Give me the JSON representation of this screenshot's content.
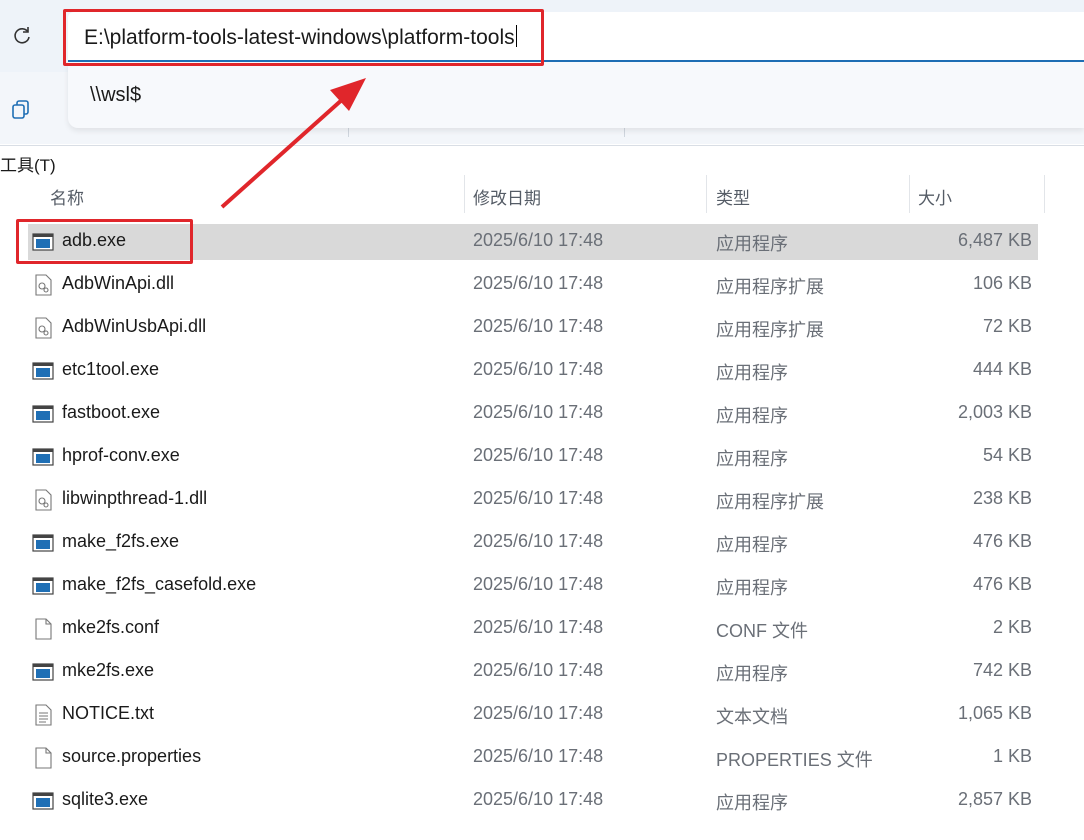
{
  "address_bar": {
    "path": "E:\\platform-tools-latest-windows\\platform-tools"
  },
  "suggestion": {
    "item": "\\\\wsl$"
  },
  "menu": {
    "tools": "工具(T)"
  },
  "columns": {
    "name": "名称",
    "date": "修改日期",
    "type": "类型",
    "size": "大小"
  },
  "files": [
    {
      "name": "adb.exe",
      "date": "2025/6/10 17:48",
      "type": "应用程序",
      "size": "6,487 KB",
      "icon": "exe-icon",
      "selected": true
    },
    {
      "name": "AdbWinApi.dll",
      "date": "2025/6/10 17:48",
      "type": "应用程序扩展",
      "size": "106 KB",
      "icon": "dll-icon"
    },
    {
      "name": "AdbWinUsbApi.dll",
      "date": "2025/6/10 17:48",
      "type": "应用程序扩展",
      "size": "72 KB",
      "icon": "dll-icon"
    },
    {
      "name": "etc1tool.exe",
      "date": "2025/6/10 17:48",
      "type": "应用程序",
      "size": "444 KB",
      "icon": "exe-icon"
    },
    {
      "name": "fastboot.exe",
      "date": "2025/6/10 17:48",
      "type": "应用程序",
      "size": "2,003 KB",
      "icon": "exe-icon"
    },
    {
      "name": "hprof-conv.exe",
      "date": "2025/6/10 17:48",
      "type": "应用程序",
      "size": "54 KB",
      "icon": "exe-icon"
    },
    {
      "name": "libwinpthread-1.dll",
      "date": "2025/6/10 17:48",
      "type": "应用程序扩展",
      "size": "238 KB",
      "icon": "dll-icon"
    },
    {
      "name": "make_f2fs.exe",
      "date": "2025/6/10 17:48",
      "type": "应用程序",
      "size": "476 KB",
      "icon": "exe-icon"
    },
    {
      "name": "make_f2fs_casefold.exe",
      "date": "2025/6/10 17:48",
      "type": "应用程序",
      "size": "476 KB",
      "icon": "exe-icon"
    },
    {
      "name": "mke2fs.conf",
      "date": "2025/6/10 17:48",
      "type": "CONF 文件",
      "size": "2 KB",
      "icon": "blank-file-icon"
    },
    {
      "name": "mke2fs.exe",
      "date": "2025/6/10 17:48",
      "type": "应用程序",
      "size": "742 KB",
      "icon": "exe-icon"
    },
    {
      "name": "NOTICE.txt",
      "date": "2025/6/10 17:48",
      "type": "文本文档",
      "size": "1,065 KB",
      "icon": "text-file-icon"
    },
    {
      "name": "source.properties",
      "date": "2025/6/10 17:48",
      "type": "PROPERTIES 文件",
      "size": "1 KB",
      "icon": "blank-file-icon"
    },
    {
      "name": "sqlite3.exe",
      "date": "2025/6/10 17:48",
      "type": "应用程序",
      "size": "2,857 KB",
      "icon": "exe-icon"
    }
  ],
  "colors": {
    "highlight": "#e0262b",
    "selected_row": "#d9d9d9",
    "accent": "#1f6fb5"
  }
}
